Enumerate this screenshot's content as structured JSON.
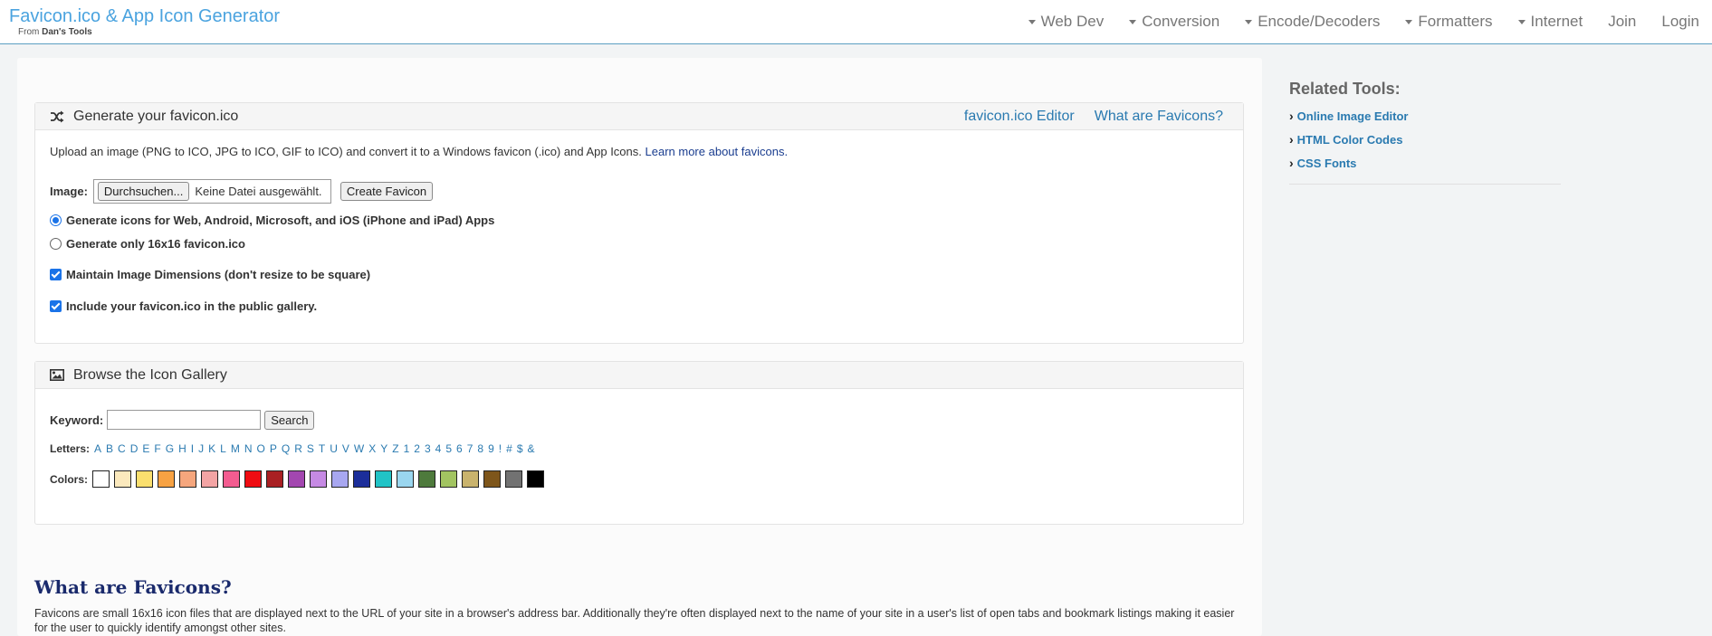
{
  "header": {
    "title": "Favicon.ico & App Icon Generator",
    "subtitle_prefix": "From",
    "subtitle_brand": "Dan's Tools",
    "nav": [
      {
        "label": "Web Dev",
        "dropdown": true
      },
      {
        "label": "Conversion",
        "dropdown": true
      },
      {
        "label": "Encode/Decoders",
        "dropdown": true
      },
      {
        "label": "Formatters",
        "dropdown": true
      },
      {
        "label": "Internet",
        "dropdown": true
      },
      {
        "label": "Join",
        "dropdown": false
      },
      {
        "label": "Login",
        "dropdown": false
      }
    ]
  },
  "generate": {
    "title": "Generate your favicon.ico",
    "link_editor": "favicon.ico Editor",
    "link_what": "What are Favicons?",
    "intro": "Upload an image (PNG to ICO, JPG to ICO, GIF to ICO) and convert it to a Windows favicon (.ico) and App Icons.",
    "intro_link": "Learn more about favicons.",
    "image_label": "Image:",
    "browse_button": "Durchsuchen...",
    "file_status": "Keine Datei ausgewählt.",
    "create_button": "Create Favicon",
    "option_all": "Generate icons for Web, Android, Microsoft, and iOS (iPhone and iPad) Apps",
    "option_16": "Generate only 16x16 favicon.ico",
    "maintain_dims": "Maintain Image Dimensions (don't resize to be square)",
    "include_gallery": "Include your favicon.ico in the public gallery."
  },
  "gallery": {
    "title": "Browse the Icon Gallery",
    "keyword_label": "Keyword:",
    "keyword_value": "",
    "search_button": "Search",
    "letters_label": "Letters:",
    "letters": [
      "A",
      "B",
      "C",
      "D",
      "E",
      "F",
      "G",
      "H",
      "I",
      "J",
      "K",
      "L",
      "M",
      "N",
      "O",
      "P",
      "Q",
      "R",
      "S",
      "T",
      "U",
      "V",
      "W",
      "X",
      "Y",
      "Z",
      "1",
      "2",
      "3",
      "4",
      "5",
      "6",
      "7",
      "8",
      "9",
      "!",
      "#",
      "$",
      "&"
    ],
    "colors_label": "Colors:",
    "colors": [
      "#ffffff",
      "#fbe9bd",
      "#fadf6e",
      "#f7a243",
      "#f5a67d",
      "#f3a4a4",
      "#f35c90",
      "#ef0c12",
      "#a92023",
      "#a347b0",
      "#c68ae4",
      "#a8a7f0",
      "#1c2e9a",
      "#21c3c6",
      "#9ad6ef",
      "#4e7a3c",
      "#a2c461",
      "#c9b36d",
      "#7e561b",
      "#727272",
      "#000000"
    ]
  },
  "about": {
    "heading": "What are Favicons?",
    "text": "Favicons are small 16x16 icon files that are displayed next to the URL of your site in a browser's address bar. Additionally they're often displayed next to the name of your site in a user's list of open tabs and bookmark listings making it easier for the user to quickly identify amongst other sites."
  },
  "sidebar": {
    "title": "Related Tools:",
    "items": [
      {
        "label": "Online Image Editor"
      },
      {
        "label": "HTML Color Codes"
      },
      {
        "label": "CSS Fonts"
      }
    ]
  }
}
